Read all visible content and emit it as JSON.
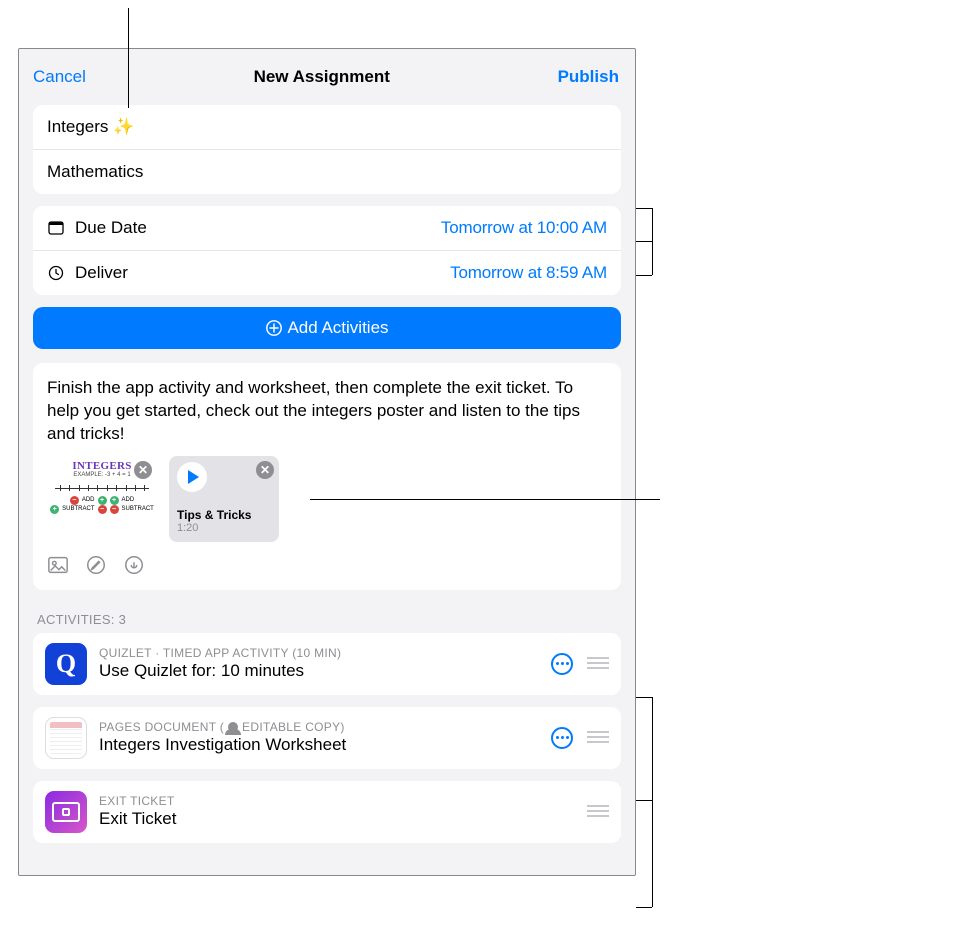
{
  "nav": {
    "cancel": "Cancel",
    "title": "New Assignment",
    "publish": "Publish"
  },
  "assignment": {
    "name": "Integers ✨",
    "subject": "Mathematics"
  },
  "dates": {
    "due_label": "Due Date",
    "due_value": "Tomorrow at 10:00 AM",
    "deliver_label": "Deliver",
    "deliver_value": "Tomorrow at 8:59 AM"
  },
  "add_activities_label": "Add Activities",
  "instructions": "Finish the app activity and worksheet, then complete the exit ticket. To help you get started, check out the integers poster and listen to the tips and tricks!",
  "attachments": {
    "poster_title": "INTEGERS",
    "poster_example": "EXAMPLE: -3 + 4 = 1",
    "poster_word_add": "ADD",
    "poster_word_sub": "SUBTRACT",
    "audio_name": "Tips & Tricks",
    "audio_duration": "1:20"
  },
  "section_label": "ACTIVITIES: 3",
  "activities": [
    {
      "meta": "QUIZLET · TIMED APP ACTIVITY (10 MIN)",
      "title": "Use Quizlet for: 10 minutes",
      "more": true
    },
    {
      "meta_a": "PAGES DOCUMENT  (",
      "meta_b": " EDITABLE COPY)",
      "title": "Integers Investigation Worksheet",
      "more": true
    },
    {
      "meta": "EXIT TICKET",
      "title": "Exit Ticket",
      "more": false
    }
  ]
}
